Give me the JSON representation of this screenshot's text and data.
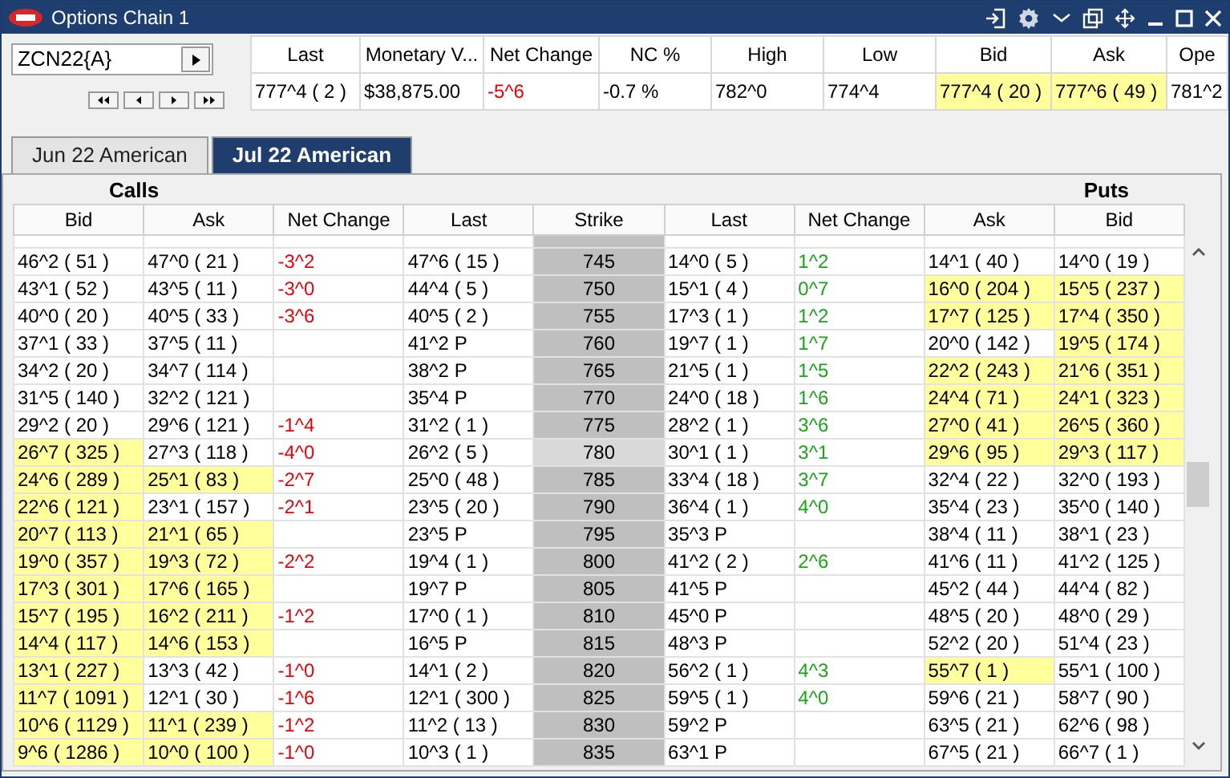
{
  "window": {
    "title": "Options Chain 1"
  },
  "symbol": {
    "value": "ZCN22{A}"
  },
  "quote": {
    "columns": [
      "Last",
      "Monetary V...",
      "Net Change",
      "NC %",
      "High",
      "Low",
      "Bid",
      "Ask",
      "Ope"
    ],
    "values": [
      {
        "text": "777^4 ( 2 )",
        "highlight": false
      },
      {
        "text": "$38,875.00",
        "highlight": false
      },
      {
        "text": "-5^6",
        "highlight": false,
        "color": "#e8000b"
      },
      {
        "text": "-0.7 %",
        "highlight": false
      },
      {
        "text": "782^0",
        "highlight": false
      },
      {
        "text": "774^4",
        "highlight": false
      },
      {
        "text": "777^4 ( 20 )",
        "highlight": true
      },
      {
        "text": "777^6 ( 49 )",
        "highlight": true
      },
      {
        "text": "781^2",
        "highlight": false
      }
    ]
  },
  "tabs": [
    {
      "label": "Jun 22 American",
      "selected": false
    },
    {
      "label": "Jul 22 American",
      "selected": true
    }
  ],
  "chain": {
    "calls_label": "Calls",
    "puts_label": "Puts",
    "columns": [
      {
        "label": "Bid"
      },
      {
        "label": "Ask"
      },
      {
        "label": "Net Change",
        "color": "#e8000b"
      },
      {
        "label": "Last"
      },
      {
        "label": "Strike"
      },
      {
        "label": "Last"
      },
      {
        "label": "Net Change",
        "color": "#1aa51a"
      },
      {
        "label": "Ask"
      },
      {
        "label": "Bid"
      }
    ],
    "rows": [
      {
        "near_money": false,
        "cells": [
          "46^2 ( 51 )",
          "47^0 ( 21 )",
          "-3^2",
          "47^6 ( 15 )",
          "745",
          "14^0 ( 5 )",
          "1^2",
          "14^1 ( 40 )",
          "14^0 ( 19 )"
        ],
        "highlights": [
          false,
          false,
          false,
          false,
          false,
          false,
          false,
          false,
          false
        ]
      },
      {
        "near_money": false,
        "cells": [
          "43^1 ( 52 )",
          "43^5 ( 11 )",
          "-3^0",
          "44^4 ( 5 )",
          "750",
          "15^1 ( 4 )",
          "0^7",
          "16^0 ( 204 )",
          "15^5 ( 237 )"
        ],
        "highlights": [
          false,
          false,
          false,
          false,
          false,
          false,
          false,
          true,
          true
        ]
      },
      {
        "near_money": false,
        "cells": [
          "40^0 ( 20 )",
          "40^5 ( 33 )",
          "-3^6",
          "40^5 ( 2 )",
          "755",
          "17^3 ( 1 )",
          "1^2",
          "17^7 ( 125 )",
          "17^4 ( 350 )"
        ],
        "highlights": [
          false,
          false,
          false,
          false,
          false,
          false,
          false,
          true,
          true
        ]
      },
      {
        "near_money": false,
        "cells": [
          "37^1 ( 33 )",
          "37^5 ( 11 )",
          null,
          "41^2 P",
          "760",
          "19^7 ( 1 )",
          "1^7",
          "20^0 ( 142 )",
          "19^5 ( 174 )"
        ],
        "highlights": [
          false,
          false,
          false,
          false,
          false,
          false,
          false,
          false,
          true
        ]
      },
      {
        "near_money": false,
        "cells": [
          "34^2 ( 20 )",
          "34^7 ( 114 )",
          null,
          "38^2 P",
          "765",
          "21^5 ( 1 )",
          "1^5",
          "22^2 ( 243 )",
          "21^6 ( 351 )"
        ],
        "highlights": [
          false,
          false,
          false,
          false,
          false,
          false,
          false,
          true,
          true
        ]
      },
      {
        "near_money": false,
        "cells": [
          "31^5 ( 140 )",
          "32^2 ( 121 )",
          null,
          "35^4 P",
          "770",
          "24^0 ( 18 )",
          "1^6",
          "24^4 ( 71 )",
          "24^1 ( 323 )"
        ],
        "highlights": [
          false,
          false,
          false,
          false,
          false,
          false,
          false,
          true,
          true
        ]
      },
      {
        "near_money": false,
        "cells": [
          "29^2 ( 20 )",
          "29^6 ( 121 )",
          "-1^4",
          "31^2 ( 1 )",
          "775",
          "28^2 ( 1 )",
          "3^6",
          "27^0 ( 41 )",
          "26^5 ( 360 )"
        ],
        "highlights": [
          false,
          false,
          false,
          false,
          false,
          false,
          false,
          true,
          true
        ]
      },
      {
        "near_money": true,
        "cells": [
          "26^7 ( 325 )",
          "27^3 ( 118 )",
          "-4^0",
          "26^2 ( 5 )",
          "780",
          "30^1 ( 1 )",
          "3^1",
          "29^6 ( 95 )",
          "29^3 ( 117 )"
        ],
        "highlights": [
          true,
          false,
          false,
          false,
          false,
          false,
          false,
          true,
          true
        ]
      },
      {
        "near_money": false,
        "cells": [
          "24^6 ( 289 )",
          "25^1 ( 83 )",
          "-2^7",
          "25^0 ( 48 )",
          "785",
          "33^4 ( 18 )",
          "3^7",
          "32^4 ( 22 )",
          "32^0 ( 193 )"
        ],
        "highlights": [
          true,
          true,
          false,
          false,
          false,
          false,
          false,
          false,
          false
        ]
      },
      {
        "near_money": false,
        "cells": [
          "22^6 ( 121 )",
          "23^1 ( 157 )",
          "-2^1",
          "23^5 ( 20 )",
          "790",
          "36^4 ( 1 )",
          "4^0",
          "35^4 ( 23 )",
          "35^0 ( 140 )"
        ],
        "highlights": [
          true,
          false,
          false,
          false,
          false,
          false,
          false,
          false,
          false
        ]
      },
      {
        "near_money": false,
        "cells": [
          "20^7 ( 113 )",
          "21^1 ( 65 )",
          null,
          "23^5 P",
          "795",
          "35^3 P",
          null,
          "38^4 ( 11 )",
          "38^1 ( 23 )"
        ],
        "highlights": [
          true,
          true,
          false,
          false,
          false,
          false,
          false,
          false,
          false
        ]
      },
      {
        "near_money": false,
        "cells": [
          "19^0 ( 357 )",
          "19^3 ( 72 )",
          "-2^2",
          "19^4 ( 1 )",
          "800",
          "41^2 ( 2 )",
          "2^6",
          "41^6 ( 11 )",
          "41^2 ( 125 )"
        ],
        "highlights": [
          true,
          true,
          false,
          false,
          false,
          false,
          false,
          false,
          false
        ]
      },
      {
        "near_money": false,
        "cells": [
          "17^3 ( 301 )",
          "17^6 ( 165 )",
          null,
          "19^7 P",
          "805",
          "41^5 P",
          null,
          "45^2 ( 44 )",
          "44^4 ( 82 )"
        ],
        "highlights": [
          true,
          true,
          false,
          false,
          false,
          false,
          false,
          false,
          false
        ]
      },
      {
        "near_money": false,
        "cells": [
          "15^7 ( 195 )",
          "16^2 ( 211 )",
          "-1^2",
          "17^0 ( 1 )",
          "810",
          "45^0 P",
          null,
          "48^5 ( 20 )",
          "48^0 ( 29 )"
        ],
        "highlights": [
          true,
          true,
          false,
          false,
          false,
          false,
          false,
          false,
          false
        ]
      },
      {
        "near_money": false,
        "cells": [
          "14^4 ( 117 )",
          "14^6 ( 153 )",
          null,
          "16^5 P",
          "815",
          "48^3 P",
          null,
          "52^2 ( 20 )",
          "51^4 ( 23 )"
        ],
        "highlights": [
          true,
          true,
          false,
          false,
          false,
          false,
          false,
          false,
          false
        ]
      },
      {
        "near_money": false,
        "cells": [
          "13^1 ( 227 )",
          "13^3 ( 42 )",
          "-1^0",
          "14^1 ( 2 )",
          "820",
          "56^2 ( 1 )",
          "4^3",
          "55^7 ( 1 )",
          "55^1 ( 100 )"
        ],
        "highlights": [
          true,
          false,
          false,
          false,
          false,
          false,
          false,
          true,
          false
        ]
      },
      {
        "near_money": false,
        "cells": [
          "11^7 ( 1091 )",
          "12^1 ( 30 )",
          "-1^6",
          "12^1 ( 300 )",
          "825",
          "59^5 ( 1 )",
          "4^0",
          "59^6 ( 21 )",
          "58^7 ( 90 )"
        ],
        "highlights": [
          true,
          false,
          false,
          false,
          false,
          false,
          false,
          false,
          false
        ]
      },
      {
        "near_money": false,
        "cells": [
          "10^6 ( 1129 )",
          "11^1 ( 239 )",
          "-1^2",
          "11^2 ( 13 )",
          "830",
          "59^2 P",
          null,
          "63^5 ( 21 )",
          "62^6 ( 98 )"
        ],
        "highlights": [
          true,
          true,
          false,
          false,
          false,
          false,
          false,
          false,
          false
        ]
      },
      {
        "near_money": false,
        "cells": [
          "9^6 ( 1286 )",
          "10^0 ( 100 )",
          "-1^0",
          "10^3 ( 1 )",
          "835",
          "63^1 P",
          null,
          "67^5 ( 21 )",
          "66^7 ( 1 )"
        ],
        "highlights": [
          true,
          true,
          false,
          false,
          false,
          false,
          false,
          false,
          false
        ]
      }
    ]
  }
}
